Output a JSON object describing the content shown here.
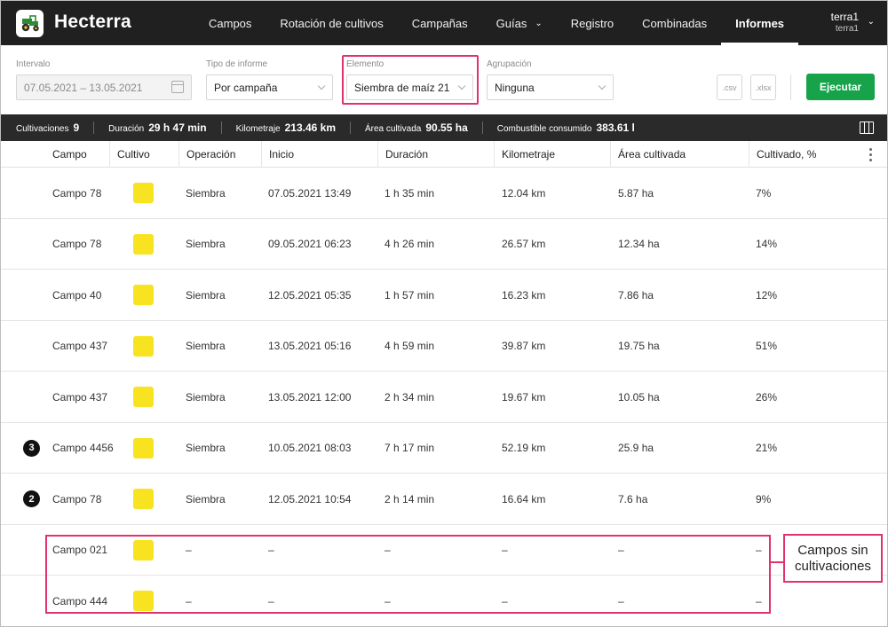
{
  "app": {
    "title": "Hecterra"
  },
  "nav": {
    "items": [
      {
        "label": "Campos"
      },
      {
        "label": "Rotación de cultivos"
      },
      {
        "label": "Campañas"
      },
      {
        "label": "Guías"
      },
      {
        "label": "Registro"
      },
      {
        "label": "Combinadas"
      },
      {
        "label": "Informes"
      }
    ],
    "active": "Informes"
  },
  "user": {
    "name": "terra1",
    "account": "terra1"
  },
  "filters": {
    "interval": {
      "label": "Intervalo",
      "value": "07.05.2021 – 13.05.2021"
    },
    "report_type": {
      "label": "Tipo de informe",
      "value": "Por campaña"
    },
    "element": {
      "label": "Elemento",
      "value": "Siembra de maíz 21"
    },
    "grouping": {
      "label": "Agrupación",
      "value": "Ninguna"
    },
    "csv_label": ".csv",
    "xlsx_label": ".xlsx",
    "run_label": "Ejecutar"
  },
  "summary": {
    "cultivations": {
      "label": "Cultivaciones",
      "value": "9"
    },
    "duration": {
      "label": "Duración",
      "value": "29 h 47 min"
    },
    "mileage": {
      "label": "Kilometraje",
      "value": "213.46 km"
    },
    "area": {
      "label": "Área cultivada",
      "value": "90.55 ha"
    },
    "fuel": {
      "label": "Combustible consumido",
      "value": "383.61 l"
    }
  },
  "table": {
    "headers": [
      "Campo",
      "Cultivo",
      "Operación",
      "Inicio",
      "Duración",
      "Kilometraje",
      "Área cultivada",
      "Cultivado, %"
    ],
    "crop_color": "#f8e320",
    "rows": [
      {
        "badge": "",
        "field": "Campo 78",
        "operation": "Siembra",
        "start": "07.05.2021 13:49",
        "duration": "1 h 35 min",
        "mileage": "12.04 km",
        "area": "5.87 ha",
        "percent": "7%"
      },
      {
        "badge": "",
        "field": "Campo 78",
        "operation": "Siembra",
        "start": "09.05.2021 06:23",
        "duration": "4 h 26 min",
        "mileage": "26.57 km",
        "area": "12.34 ha",
        "percent": "14%"
      },
      {
        "badge": "",
        "field": "Campo 40",
        "operation": "Siembra",
        "start": "12.05.2021 05:35",
        "duration": "1 h 57 min",
        "mileage": "16.23 km",
        "area": "7.86 ha",
        "percent": "12%"
      },
      {
        "badge": "",
        "field": "Campo 437",
        "operation": "Siembra",
        "start": "13.05.2021 05:16",
        "duration": "4 h 59 min",
        "mileage": "39.87 km",
        "area": "19.75 ha",
        "percent": "51%"
      },
      {
        "badge": "",
        "field": "Campo 437",
        "operation": "Siembra",
        "start": "13.05.2021 12:00",
        "duration": "2 h 34 min",
        "mileage": "19.67 km",
        "area": "10.05 ha",
        "percent": "26%"
      },
      {
        "badge": "3",
        "field": "Campo 4456",
        "operation": "Siembra",
        "start": "10.05.2021 08:03",
        "duration": "7 h 17 min",
        "mileage": "52.19 km",
        "area": "25.9 ha",
        "percent": "21%"
      },
      {
        "badge": "2",
        "field": "Campo 78",
        "operation": "Siembra",
        "start": "12.05.2021 10:54",
        "duration": "2 h 14 min",
        "mileage": "16.64 km",
        "area": "7.6 ha",
        "percent": "9%"
      },
      {
        "badge": "",
        "field": "Campo 021",
        "operation": "–",
        "start": "–",
        "duration": "–",
        "mileage": "–",
        "area": "–",
        "percent": "–"
      },
      {
        "badge": "",
        "field": "Campo 444",
        "operation": "–",
        "start": "–",
        "duration": "–",
        "mileage": "–",
        "area": "–",
        "percent": "–"
      }
    ]
  },
  "annotation": {
    "label": "Campos sin cultivaciones"
  },
  "colors": {
    "accent": "#16a34a",
    "highlight": "#e0336b",
    "nav_bg": "#202020"
  }
}
